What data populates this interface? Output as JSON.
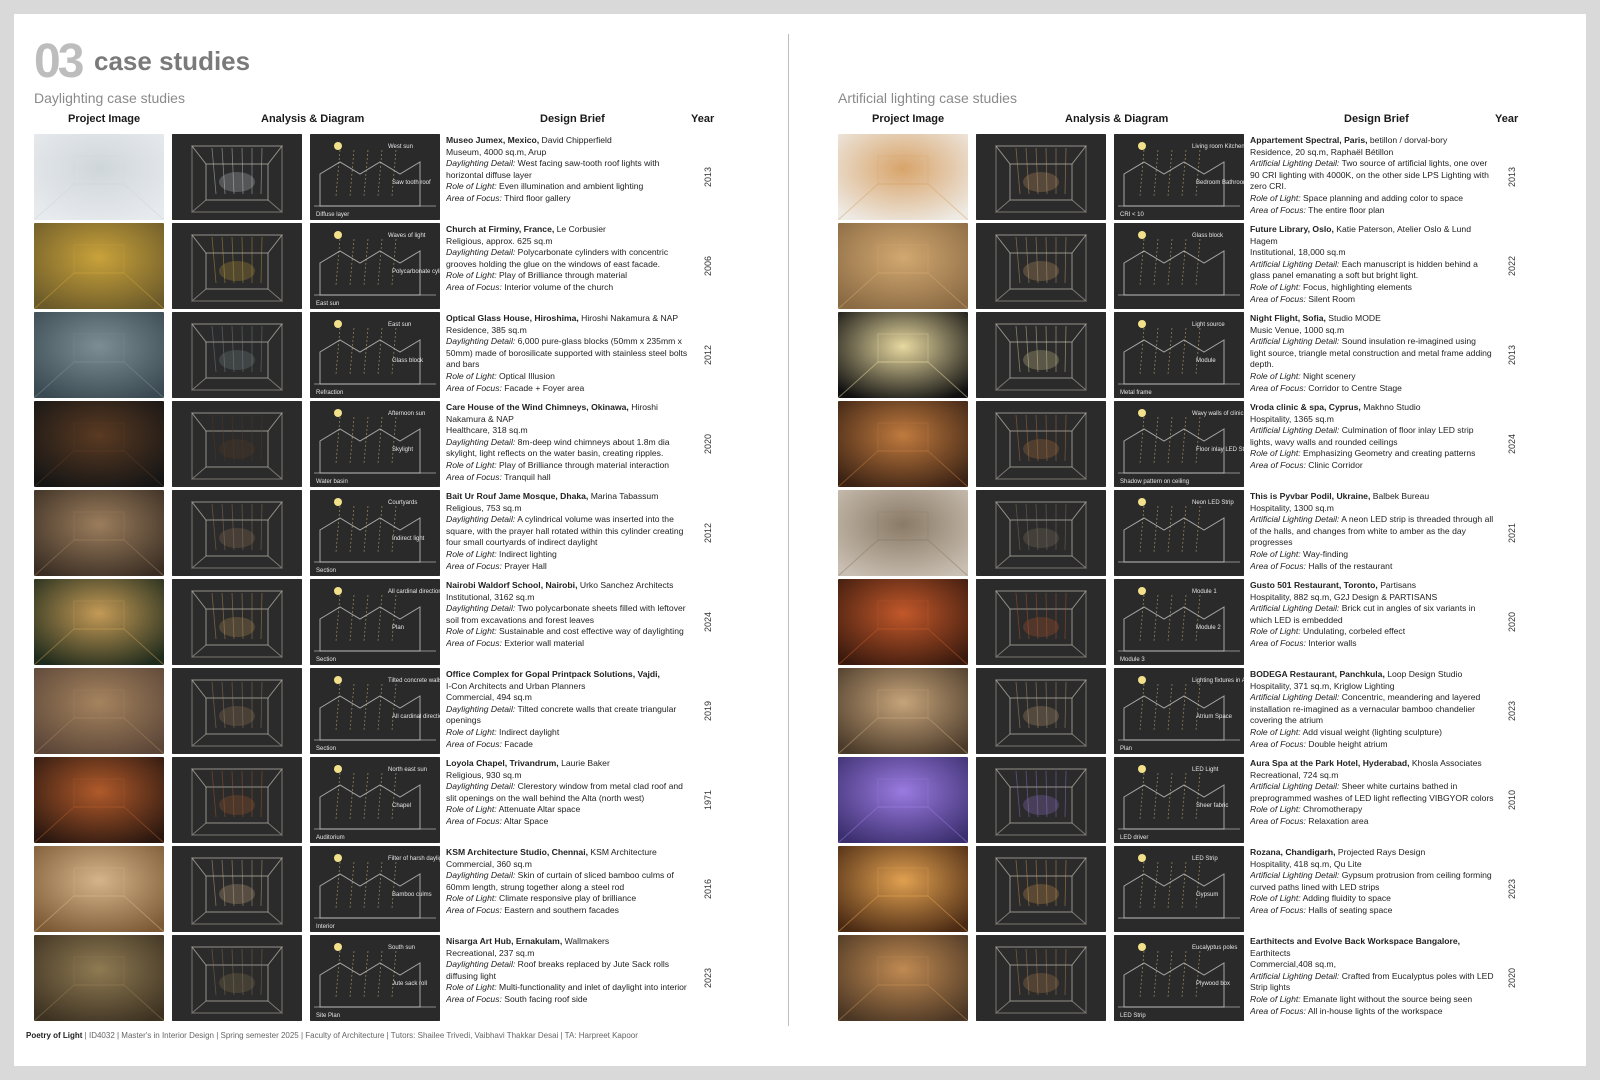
{
  "header": {
    "number": "03",
    "title": "case studies"
  },
  "columns": {
    "image": "Project Image",
    "analysis": "Analysis & Diagram",
    "brief": "Design Brief",
    "year": "Year"
  },
  "left": {
    "title": "Daylighting case studies",
    "rows": [
      {
        "title": "Museo Jumex, Mexico,",
        "author": "David Chipperfield",
        "meta": "Museum, 4000 sq.m, Arup",
        "detail_label": "Daylighting Detail:",
        "detail": "West facing saw-tooth roof lights with horizontal diffuse layer",
        "role": "Even illumination and ambient lighting",
        "focus": "Third floor gallery",
        "year": "2013",
        "labels": [
          "West sun",
          "Saw tooth roof",
          "Diffuse layer"
        ],
        "img": "#e8ebee",
        "tone": "#cfd6da"
      },
      {
        "title": "Church at Firminy, France,",
        "author": "Le Corbusier",
        "meta": "Religious, approx. 625 sq.m",
        "detail_label": "Daylighting Detail:",
        "detail": "Polycarbonate cylinders with concentric grooves holding the glue on the windows of east facade.",
        "role": "Play of Brilliance through material",
        "focus": "Interior volume of the church",
        "year": "2006",
        "labels": [
          "Waves of light",
          "Polycarbonate cylinders",
          "East sun"
        ],
        "img": "#6b5a2a",
        "tone": "#c9a23a"
      },
      {
        "title": "Optical Glass House, Hiroshima,",
        "author": "Hiroshi Nakamura & NAP",
        "meta": "Residence, 385 sq.m",
        "detail_label": "Daylighting Detail:",
        "detail": "6,000 pure-glass blocks (50mm x 235mm x 50mm) made of borosilicate supported with stainless steel bolts and bars",
        "role": "Optical Illusion",
        "focus": "Facade + Foyer area",
        "year": "2012",
        "labels": [
          "East sun",
          "Glass block",
          "Refraction"
        ],
        "img": "#3b4a52",
        "tone": "#7c8e94"
      },
      {
        "title": "Care House of the Wind Chimneys, Okinawa,",
        "author": "Hiroshi Nakamura & NAP",
        "meta": "Healthcare, 318 sq.m",
        "detail_label": "Daylighting Detail:",
        "detail": "8m-deep wind chimneys about 1.8m dia skylight, light reflects on the water basin, creating ripples.",
        "role": "Play of Brilliance through material interaction",
        "focus": "Tranquil hall",
        "year": "2020",
        "labels": [
          "Afternoon sun",
          "Skylight",
          "Water basin"
        ],
        "img": "#151515",
        "tone": "#5a3a22"
      },
      {
        "title": "Bait Ur Rouf Jame Mosque, Dhaka,",
        "author": "Marina Tabassum",
        "meta": "Religious, 753 sq.m",
        "detail_label": "Daylighting Detail:",
        "detail": "A cylindrical volume was inserted into the square, with the prayer hall rotated within this cylinder creating four small courtyards of indirect daylight",
        "role": "Indirect lighting",
        "focus": "Prayer Hall",
        "year": "2012",
        "labels": [
          "Courtyards",
          "Indirect light",
          "Section"
        ],
        "img": "#3a2e24",
        "tone": "#9b7d5c"
      },
      {
        "title": "Nairobi Waldorf School, Nairobi,",
        "author": "Urko Sanchez Architects",
        "meta": "Institutional, 3162 sq.m",
        "detail_label": "Daylighting Detail:",
        "detail": "Two polycarbonate sheets filled with leftover soil from excavations and forest leaves",
        "role": "Sustainable and cost effective way of daylighting",
        "focus": "Exterior wall material",
        "year": "2024",
        "labels": [
          "All cardinal directions",
          "Plan",
          "Section"
        ],
        "img": "#1f2b1c",
        "tone": "#c49a56"
      },
      {
        "title": "Office Complex for Gopal Printpack Solutions, Vajdi,",
        "author": "",
        "meta2": "I-Con Architects and Urban Planners",
        "meta": "Commercial, 494 sq.m",
        "detail_label": "Daylighting Detail:",
        "detail": "Tilted concrete walls that create triangular openings",
        "role": "Indirect daylight",
        "focus": "Facade",
        "year": "2019",
        "labels": [
          "Tilted concrete walls",
          "All cardinal directions",
          "Section"
        ],
        "img": "#5b4638",
        "tone": "#a5835e"
      },
      {
        "title": "Loyola Chapel, Trivandrum,",
        "author": "Laurie Baker",
        "meta": "Religious, 930 sq.m",
        "detail_label": "Daylighting Detail:",
        "detail": "Clerestory window from metal clad roof and slit openings on the wall behind the Alta (north west)",
        "role": "Attenuate Altar space",
        "focus": "Altar Space",
        "year": "1971",
        "labels": [
          "North east sun",
          "Chapel",
          "Auditorium"
        ],
        "img": "#2a1710",
        "tone": "#b05a2a"
      },
      {
        "title": "KSM Architecture Studio, Chennai,",
        "author": "KSM Architecture",
        "meta": "Commercial, 360 sq.m",
        "detail_label": "Daylighting Detail:",
        "detail": "Skin of curtain of sliced bamboo culms of 60mm length, strung together along a steel rod",
        "role": "Climate responsive play of brilliance",
        "focus": "Eastern and southern facades",
        "year": "2016",
        "labels": [
          "Filter of harsh daylight",
          "Bamboo culms",
          "Interior"
        ],
        "img": "#7c5a36",
        "tone": "#d6b48a"
      },
      {
        "title": "Nisarga Art Hub, Ernakulam,",
        "author": "Wallmakers",
        "meta": "Recreational, 237 sq.m",
        "detail_label": "Daylighting Detail:",
        "detail": "Roof breaks replaced by Jute Sack rolls diffusing light",
        "role": "Multi-functionality and inlet of daylight into interior",
        "focus": "South facing roof side",
        "year": "2023",
        "labels": [
          "South sun",
          "Jute sack roll",
          "Site Plan"
        ],
        "img": "#3d3222",
        "tone": "#8f7a52"
      }
    ]
  },
  "right": {
    "title": "Artificial lighting case studies",
    "rows": [
      {
        "title": "Appartement Spectral, Paris,",
        "author": "betillon / dorval-bory",
        "meta": "Residence, 20 sq.m, Raphaël Bétillon",
        "detail_label": "Artificial Lighting Detail:",
        "detail": "Two source of artificial lights, one over 90 CRI lighting with 4000K, on the other side LPS Lighting with zero CRI.",
        "role": "Space planning and adding color to space",
        "focus": "The entire floor plan",
        "year": "2013",
        "labels": [
          "Living room Kitchen etc.",
          "Bedroom Bathroom etc.",
          "CRI < 10"
        ],
        "img": "#eeeae4",
        "tone": "#d8a46a"
      },
      {
        "title": "Future Library, Oslo,",
        "author": "Katie Paterson, Atelier Oslo & Lund Hagem",
        "meta": "Institutional, 18,000 sq.m",
        "detail_label": "Artificial Lighting Detail:",
        "detail": "Each manuscript is hidden behind a glass panel emanating a soft but bright light.",
        "role": "Focus, highlighting elements",
        "focus": "Silent Room",
        "year": "2022",
        "labels": [
          "Glass block",
          "",
          ""
        ],
        "img": "#8a6a44",
        "tone": "#d2a870"
      },
      {
        "title": "Night Flight, Sofia,",
        "author": "Studio MODE",
        "meta": "Music Venue, 1000 sq.m",
        "detail_label": "Artificial Lighting Detail:",
        "detail": "Sound insulation re-imagined using light source, triangle metal construction and metal frame adding depth.",
        "role": "Night scenery",
        "focus": "Corridor to Centre Stage",
        "year": "2013",
        "labels": [
          "Light source",
          "Module",
          "Metal frame"
        ],
        "img": "#101010",
        "tone": "#e8d9a0"
      },
      {
        "title": "Vroda clinic & spa, Cyprus,",
        "author": "Makhno Studio",
        "meta": "Hospitality, 1365 sq.m",
        "detail_label": "Artificial Lighting Detail:",
        "detail": "Culmination of floor inlay LED strip lights, wavy walls and rounded ceilings",
        "role": "Emphasizing Geometry and creating patterns",
        "focus": "Clinic Corridor",
        "year": "2024",
        "labels": [
          "Wavy walls of clinic corridors",
          "Floor inlay LED Strip",
          "Shadow pattern on ceiling"
        ],
        "img": "#3a2214",
        "tone": "#c07a3e"
      },
      {
        "title": "This is Pyvbar Podil, Ukraine,",
        "author": "Balbek Bureau",
        "meta": "Hospitality, 1300 sq.m",
        "detail_label": "Artificial Lighting Detail:",
        "detail": "A neon LED strip is threaded through all of the halls, and changes from white to amber as the day progresses",
        "role": "Way-finding",
        "focus": "Halls of the restaurant",
        "year": "2021",
        "labels": [
          "Neon LED Strip",
          "",
          ""
        ],
        "img": "#c9bfb2",
        "tone": "#8a7a66"
      },
      {
        "title": "Gusto 501 Restaurant, Toronto,",
        "author": "Partisans",
        "meta": "Hospitality, 882 sq.m, G2J Design & PARTISANS",
        "detail_label": "Artificial Lighting Detail:",
        "detail": "Brick cut in angles of six variants in which LED is embedded",
        "role": "Undulating, corbeled effect",
        "focus": "Interior walls",
        "year": "2020",
        "labels": [
          "Module 1",
          "Module 2",
          "Module 3"
        ],
        "img": "#3a1a0e",
        "tone": "#c2582a"
      },
      {
        "title": "BODEGA Restaurant, Panchkula,",
        "author": "Loop Design Studio",
        "meta": "Hospitality, 371 sq.m, Kriglow Lighting",
        "detail_label": "Artificial Lighting Detail:",
        "detail": "Concentric, meandering and layered installation re-imagined as a vernacular bamboo chandelier covering the atrium",
        "role": "Add visual weight (lighting sculpture)",
        "focus": "Double height atrium",
        "year": "2023",
        "labels": [
          "Lighting fixtures in Atrium",
          "Atrium Space",
          "Plan"
        ],
        "img": "#4a3a2a",
        "tone": "#c6a47a"
      },
      {
        "title": "Aura Spa at the Park Hotel, Hyderabad,",
        "author": "Khosla Associates",
        "meta": "Recreational, 724 sq.m",
        "detail_label": "Artificial Lighting Detail:",
        "detail": "Sheer white curtains bathed in preprogrammed washes of LED light reflecting VIBGYOR colors",
        "role": "Chromotherapy",
        "focus": "Relaxation area",
        "year": "2010",
        "labels": [
          "LED Light",
          "Sheer fabric",
          "LED driver"
        ],
        "img": "#3b2f6e",
        "tone": "#9a7ae0"
      },
      {
        "title": "Rozana, Chandigarh,",
        "author": "Projected Rays Design",
        "meta": "Hospitality, 418 sq.m, Qu Lite",
        "detail_label": "Artificial Lighting Detail:",
        "detail": "Gypsum protrusion from ceiling forming curved paths lined with LED strips",
        "role": "Adding fluidity to space",
        "focus": "Halls of seating space",
        "year": "2023",
        "labels": [
          "LED Strip",
          "Gypsum",
          ""
        ],
        "img": "#4a2a14",
        "tone": "#e0a050"
      },
      {
        "title": "Earthitects and Evolve Back Workspace Bangalore,",
        "author": "",
        "meta2": "Earthitects",
        "meta": "Commercial,408 sq.m,",
        "detail_label": "Artificial Lighting Detail:",
        "detail": "Crafted from Eucalyptus poles with LED Strip lights",
        "role": "Emanate light without the source being seen",
        "focus": "All in-house lights of the workspace",
        "year": "2020",
        "labels": [
          "Eucalyptus poles",
          "Plywood box",
          "LED Strip"
        ],
        "img": "#4a3624",
        "tone": "#c08a52"
      }
    ]
  },
  "role_label": "Role of Light:",
  "focus_label": "Area of Focus:",
  "footer": {
    "brand": "Poetry of Light",
    "text": " | ID4032 | Master's in Interior Design | Spring semester 2025 | Faculty of Architecture | Tutors: Shailee Trivedi, Vaibhavi Thakkar Desai | TA: Harpreet Kapoor"
  }
}
